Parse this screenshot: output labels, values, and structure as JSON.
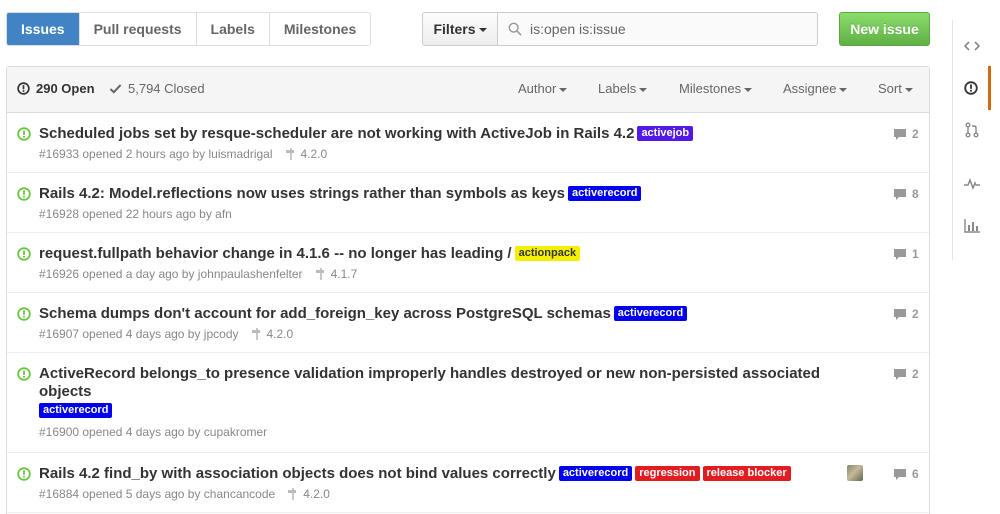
{
  "subnav": {
    "issues": "Issues",
    "pull_requests": "Pull requests",
    "labels": "Labels",
    "milestones": "Milestones"
  },
  "filters_label": "Filters",
  "search": {
    "value": "is:open is:issue"
  },
  "new_issue_label": "New issue",
  "header": {
    "open_count": "290 Open",
    "closed_count": "5,794 Closed",
    "author": "Author",
    "labels": "Labels",
    "milestones": "Milestones",
    "assignee": "Assignee",
    "sort": "Sort"
  },
  "colors": {
    "open_icon": "#6cc644",
    "activejob": "#5319e7",
    "activerecord": "#0000ee",
    "actionpack": "#f4ef00",
    "regression": "#e11d21",
    "release_blocker": "#e11d21"
  },
  "issues": [
    {
      "title": "Scheduled jobs set by resque-scheduler are not working with ActiveJob in Rails 4.2",
      "labels": [
        "activejob"
      ],
      "meta": "#16933 opened 2 hours ago by luismadrigal",
      "milestone": "4.2.0",
      "comments": "2"
    },
    {
      "title": "Rails 4.2: Model.reflections now uses strings rather than symbols as keys",
      "labels": [
        "activerecord"
      ],
      "meta": "#16928 opened 22 hours ago by afn",
      "milestone": "",
      "comments": "8"
    },
    {
      "title": "request.fullpath behavior change in 4.1.6 -- no longer has leading /",
      "labels": [
        "actionpack"
      ],
      "meta": "#16926 opened a day ago by johnpaulashenfelter",
      "milestone": "4.1.7",
      "comments": "1"
    },
    {
      "title": "Schema dumps don't account for add_foreign_key across PostgreSQL schemas",
      "labels": [
        "activerecord"
      ],
      "meta": "#16907 opened 4 days ago by jpcody",
      "milestone": "4.2.0",
      "comments": "2"
    },
    {
      "title": "ActiveRecord belongs_to presence validation improperly handles destroyed or new non-persisted associated objects",
      "labels": [
        "activerecord"
      ],
      "meta": "#16900 opened 4 days ago by cupakromer",
      "milestone": "",
      "comments": "2"
    },
    {
      "title": "Rails 4.2 find_by with association objects does not bind values correctly",
      "labels": [
        "activerecord",
        "regression",
        "release blocker"
      ],
      "meta": "#16884 opened 5 days ago by chancancode",
      "milestone": "4.2.0",
      "comments": "6"
    }
  ]
}
